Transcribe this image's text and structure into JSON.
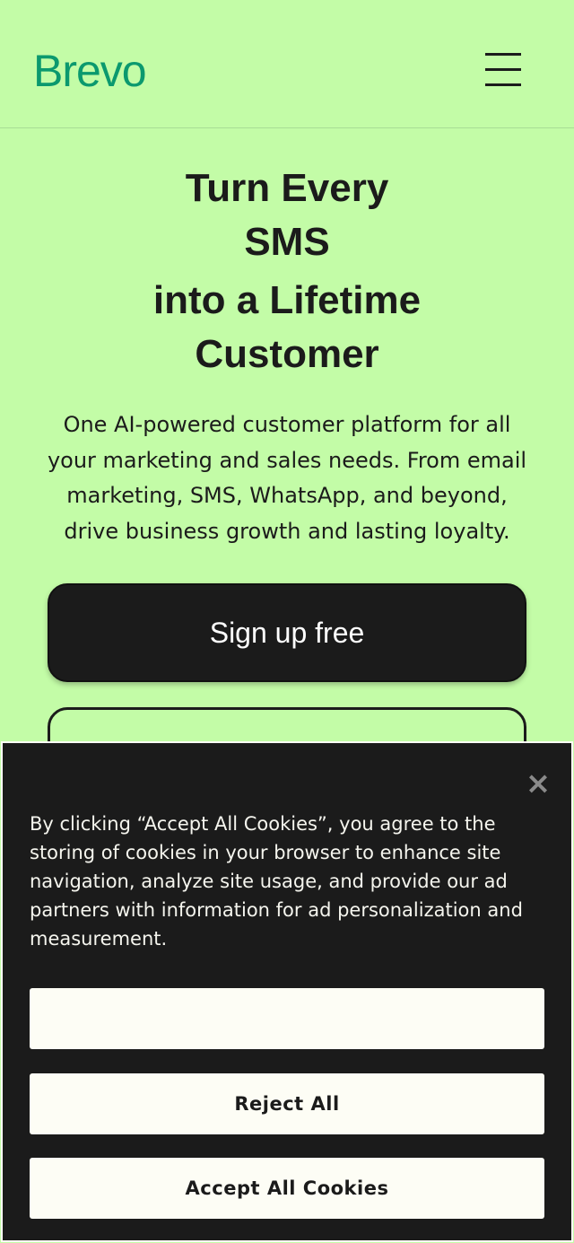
{
  "header": {
    "logo_text": "Brevo",
    "menu_icon": "hamburger-icon"
  },
  "hero": {
    "title_lines": [
      "Turn Every",
      "SMS",
      "into a Lifetime",
      "Customer"
    ],
    "subtitle": "One AI-powered customer platform for all your marketing and sales needs. From email marketing, SMS, WhatsApp, and beyond, drive business growth and lasting loyalty.",
    "signup_label": "Sign up free",
    "second_cta_label": ""
  },
  "cookie_banner": {
    "close_icon": "close-icon",
    "message": "By clicking “Accept All Cookies”, you agree to the storing of cookies in your browser to enhance site navigation, analyze site usage, and provide our ad partners with information for ad personalization and measurement.",
    "settings_label": "",
    "reject_label": "Reject All",
    "accept_label": "Accept All Cookies"
  },
  "colors": {
    "background": "#c3fca7",
    "brand_green": "#0b996e",
    "dark": "#1b1b1b",
    "cookie_button": "#fdfdf5"
  }
}
